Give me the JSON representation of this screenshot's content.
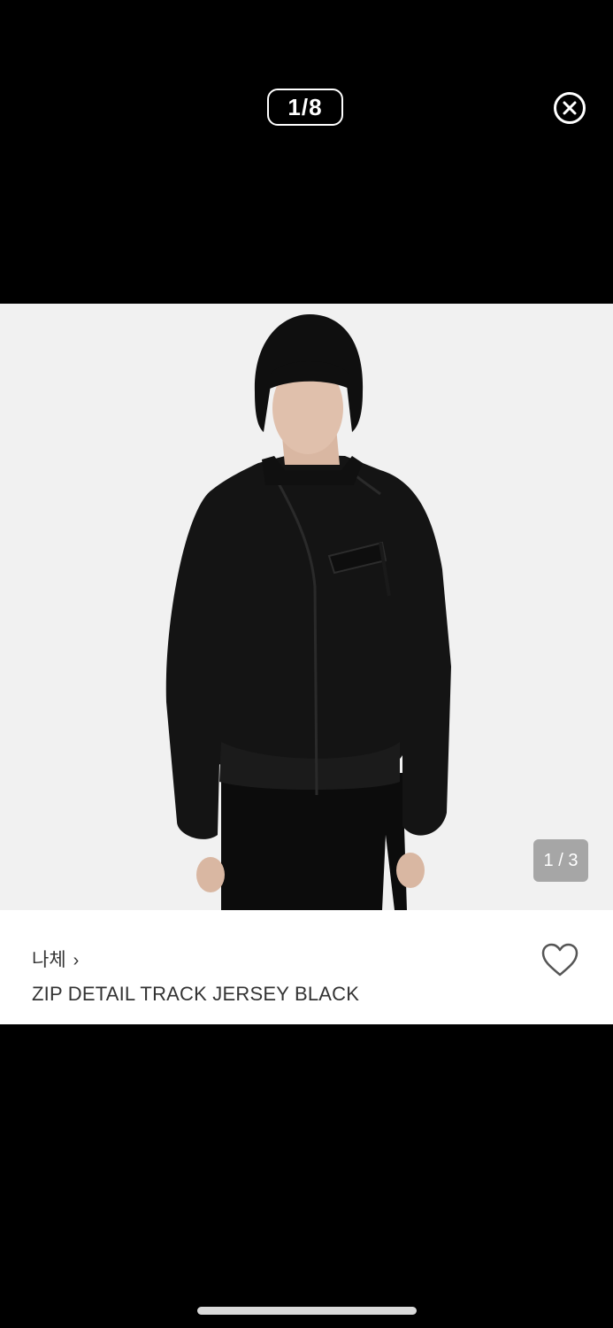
{
  "viewer": {
    "counter": "1/8",
    "close_icon": "close-circle-icon"
  },
  "product_image": {
    "counter": "1 / 3",
    "description_alt": "ZIP DETAIL TRACK JERSEY BLACK"
  },
  "product": {
    "brand": "나체",
    "brand_chevron": "›",
    "name": "ZIP DETAIL TRACK JERSEY BLACK",
    "wishlist_icon": "heart-outline-icon"
  },
  "colors": {
    "background": "#000000",
    "photo_bg": "#f1f1f1",
    "text": "#333333"
  }
}
